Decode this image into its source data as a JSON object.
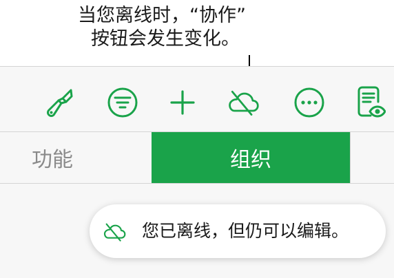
{
  "callout": {
    "line1": "当您离线时，“协作”",
    "line2": "按钮会发生变化。"
  },
  "toolbar": {
    "buttons": [
      {
        "name": "format-brush-icon"
      },
      {
        "name": "filter-icon"
      },
      {
        "name": "add-icon"
      },
      {
        "name": "offline-cloud-icon"
      },
      {
        "name": "more-icon"
      },
      {
        "name": "reading-view-icon"
      }
    ]
  },
  "tabs": {
    "inactive_label": "功能",
    "active_label": "组织"
  },
  "toast": {
    "icon": "offline-cloud-icon",
    "message": "您已离线，但仍可以编辑。"
  },
  "colors": {
    "accent": "#1aa34a",
    "toolbar_bg": "#f7f7f7"
  }
}
